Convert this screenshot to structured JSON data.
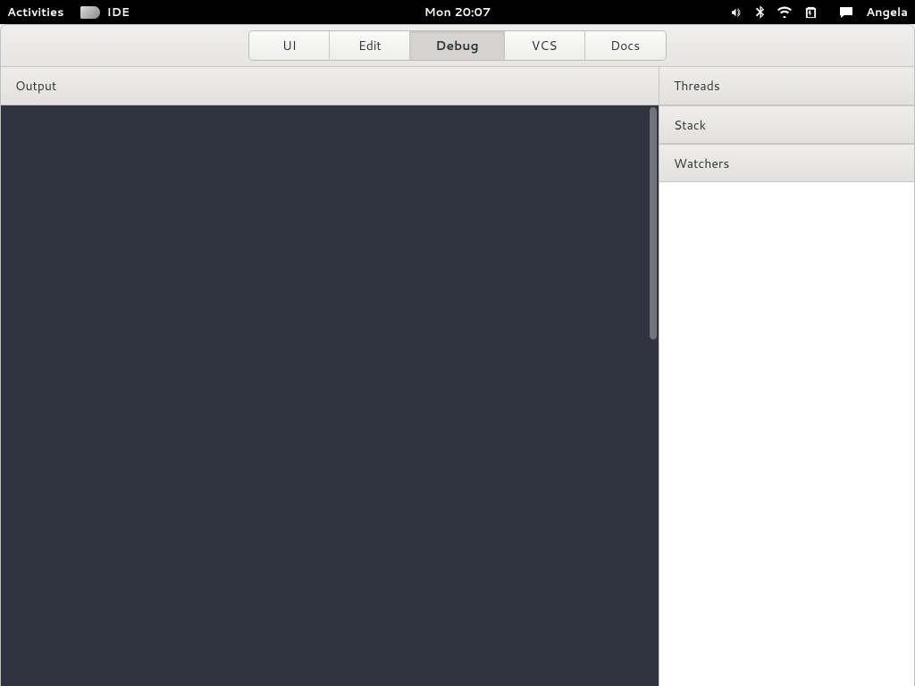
{
  "topbar": {
    "activities": "Activities",
    "app_name": "IDE",
    "clock": "Mon 20:07",
    "username": "Angela"
  },
  "headerbar": {
    "tabs": [
      {
        "label": "UI"
      },
      {
        "label": "Edit"
      },
      {
        "label": "Debug"
      },
      {
        "label": "VCS"
      },
      {
        "label": "Docs"
      }
    ],
    "active_index": 2
  },
  "panels": {
    "output": "Output",
    "threads": "Threads",
    "stack": "Stack",
    "watchers": "Watchers"
  }
}
